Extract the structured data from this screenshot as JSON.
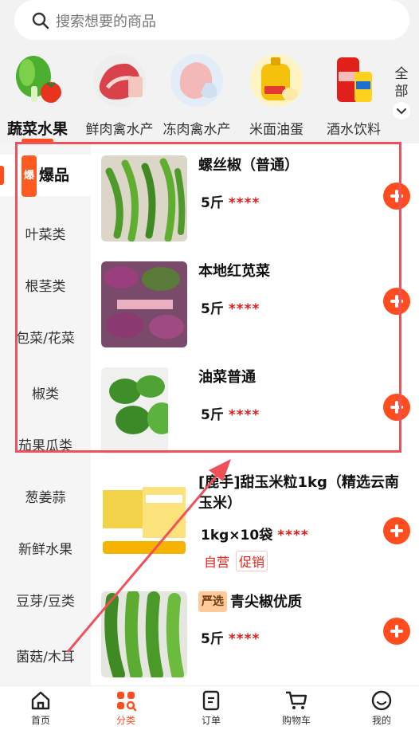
{
  "search": {
    "placeholder": "搜索想要的商品"
  },
  "categories": [
    {
      "label": "蔬菜水果",
      "active": true
    },
    {
      "label": "鲜肉禽水产",
      "active": false
    },
    {
      "label": "冻肉禽水产",
      "active": false
    },
    {
      "label": "米面油蛋",
      "active": false
    },
    {
      "label": "酒水饮料",
      "active": false
    }
  ],
  "all_button": {
    "line1": "全",
    "line2": "部"
  },
  "sidebar": {
    "items": [
      {
        "label": "爆品",
        "tag": "爆",
        "active": true
      },
      {
        "label": "叶菜类"
      },
      {
        "label": "根茎类"
      },
      {
        "label": "包菜/花菜"
      },
      {
        "label": "椒类"
      },
      {
        "label": "茄果瓜类"
      },
      {
        "label": "葱姜蒜"
      },
      {
        "label": "新鲜水果"
      },
      {
        "label": "豆芽/豆类"
      },
      {
        "label": "菌菇/木耳"
      }
    ]
  },
  "products": [
    {
      "name": "螺丝椒（普通）",
      "spec": "5斤",
      "stars": "****"
    },
    {
      "name": "本地红苋菜",
      "spec": "5斤",
      "stars": "****"
    },
    {
      "name": "油菜普通",
      "spec": "5斤",
      "stars": "****"
    },
    {
      "name": "[鹿手]甜玉米粒1kg（精选云南玉米）",
      "spec": "1kg×10袋",
      "stars": "****",
      "badges": [
        "自营",
        "促销"
      ]
    },
    {
      "name": "青尖椒优质",
      "tag": "严选",
      "spec": "5斤",
      "stars": "****"
    }
  ],
  "tabs": [
    {
      "label": "首页",
      "icon": "home-icon",
      "active": false
    },
    {
      "label": "分类",
      "icon": "category-icon",
      "active": true
    },
    {
      "label": "订单",
      "icon": "order-icon",
      "active": false
    },
    {
      "label": "购物车",
      "icon": "cart-icon",
      "active": false
    },
    {
      "label": "我的",
      "icon": "profile-icon",
      "active": false
    }
  ],
  "colors": {
    "accent": "#ff4d1f",
    "annotation": "#f0505a",
    "stars": "#e31b1b"
  }
}
